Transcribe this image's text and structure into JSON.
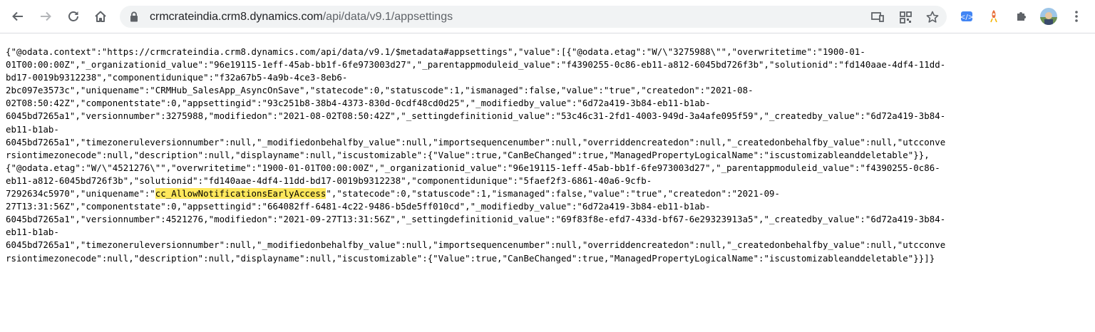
{
  "browser": {
    "url_host": "crmcrateindia.crm8.dynamics.com",
    "url_path": "/api/data/v9.1/appsettings",
    "toolbar_icons": [
      "back-icon",
      "forward-icon",
      "reload-icon",
      "home-icon",
      "lock-icon",
      "cast-icon",
      "qr-code-icon",
      "star-icon",
      "extension-blue-icon",
      "rocket-extension-icon",
      "puzzle-extensions-icon",
      "profile-avatar",
      "more-menu-icon"
    ]
  },
  "colors": {
    "highlight": "#ffe85c",
    "omnibox": "#f1f3f4",
    "icon": "#5f6368"
  },
  "json_text": {
    "lines_1_6": [
      "{\"@odata.context\":\"https://crmcrateindia.crm8.dynamics.com/api/data/v9.1/$metadata#appsettings\",\"value\":[{\"@odata.etag\":\"W/\\\"3275988\\\"\",\"overwritetime\":\"1900-01-",
      "01T00:00:00Z\",\"_organizationid_value\":\"96e19115-1eff-45ab-bb1f-6fe973003d27\",\"_parentappmoduleid_value\":\"f4390255-0c86-eb11-a812-6045bd726f3b\",\"solutionid\":\"fd140aae-4df4-11dd-",
      "bd17-0019b9312238\",\"componentidunique\":\"f32a67b5-4a9b-4ce3-8eb6-",
      "2bc097e3573c\",\"uniquename\":\"CRMHub_SalesApp_AsyncOnSave\",\"statecode\":0,\"statuscode\":1,\"ismanaged\":false,\"value\":\"true\",\"createdon\":\"2021-08-",
      "02T08:50:42Z\",\"componentstate\":0,\"appsettingid\":\"93c251b8-38b4-4373-830d-0cdf48cd0d25\",\"_modifiedby_value\":\"6d72a419-3b84-eb11-b1ab-",
      "6045bd7265a1\",\"versionnumber\":3275988,\"modifiedon\":\"2021-08-02T08:50:42Z\",\"_settingdefinitionid_value\":\"53c46c31-2fd1-4003-949d-3a4afe095f59\",\"_createdby_value\":\"6d72a419-3b84-"
    ],
    "lines_7_13": [
      "eb11-b1ab-",
      "6045bd7265a1\",\"timezoneruleversionnumber\":null,\"_modifiedonbehalfby_value\":null,\"importsequencenumber\":null,\"overriddencreatedon\":null,\"_createdonbehalfby_value\":null,\"utcconve",
      "rsiontimezonecode\":null,\"description\":null,\"displayname\":null,\"iscustomizable\":{\"Value\":true,\"CanBeChanged\":true,\"ManagedPropertyLogicalName\":\"iscustomizableanddeletable\"}},",
      "{\"@odata.etag\":\"W/\\\"4521276\\\"\",\"overwritetime\":\"1900-01-01T00:00:00Z\",\"_organizationid_value\":\"96e19115-1eff-45ab-bb1f-6fe973003d27\",\"_parentappmoduleid_value\":\"f4390255-0c86-",
      "eb11-a812-6045bd726f3b\",\"solutionid\":\"fd140aae-4df4-11dd-bd17-0019b9312238\",\"componentidunique\":\"5faef2f3-6861-40a6-9cfb-"
    ],
    "line_14_pre": "7292634c5970\",\"uniquename\":\"",
    "highlighted": "cc_AllowNotificationsEarlyAccess",
    "line_14_post": "\",\"statecode\":0,\"statuscode\":1,\"ismanaged\":false,\"value\":\"true\",\"createdon\":\"2021-09-",
    "lines_15_end": [
      "27T13:31:56Z\",\"componentstate\":0,\"appsettingid\":\"664082ff-6481-4c22-9486-b5de5ff010cd\",\"_modifiedby_value\":\"6d72a419-3b84-eb11-b1ab-",
      "6045bd7265a1\",\"versionnumber\":4521276,\"modifiedon\":\"2021-09-27T13:31:56Z\",\"_settingdefinitionid_value\":\"69f83f8e-efd7-433d-bf67-6e29323913a5\",\"_createdby_value\":\"6d72a419-3b84-",
      "eb11-b1ab-",
      "6045bd7265a1\",\"timezoneruleversionnumber\":null,\"_modifiedonbehalfby_value\":null,\"importsequencenumber\":null,\"overriddencreatedon\":null,\"_createdonbehalfby_value\":null,\"utcconve",
      "rsiontimezonecode\":null,\"description\":null,\"displayname\":null,\"iscustomizable\":{\"Value\":true,\"CanBeChanged\":true,\"ManagedPropertyLogicalName\":\"iscustomizableanddeletable\"}}]}"
    ]
  }
}
